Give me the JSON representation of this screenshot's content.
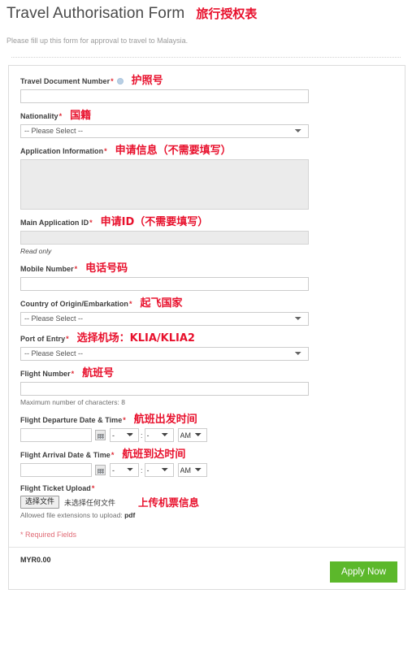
{
  "header": {
    "title": "Travel Authorisation Form",
    "title_annotation": "旅行授权表",
    "subtitle": "Please fill up this form for approval to travel to Malaysia."
  },
  "form": {
    "fields": [
      {
        "id": "travel-document-number",
        "label": "Travel Document Number",
        "required_mark": "*",
        "has_help_icon": true,
        "annotation": "护照号",
        "control": "text",
        "value": ""
      },
      {
        "id": "nationality",
        "label": "Nationality",
        "required_mark": "*",
        "annotation": "国籍",
        "control": "select",
        "selected": "-- Please Select --"
      },
      {
        "id": "application-information",
        "label": "Application Information",
        "required_mark": "*",
        "annotation": "申请信息（不需要填写）",
        "control": "textarea",
        "value": "",
        "disabled": true
      },
      {
        "id": "main-application-id",
        "label": "Main Application ID",
        "required_mark": "*",
        "annotation": "申请ID（不需要填写）",
        "control": "text",
        "value": "",
        "readonly": true,
        "hint": "Read only"
      },
      {
        "id": "mobile-number",
        "label": "Mobile Number",
        "required_mark": "*",
        "annotation": "电话号码",
        "control": "text",
        "value": ""
      },
      {
        "id": "country-of-origin",
        "label": "Country of Origin/Embarkation",
        "required_mark": "*",
        "annotation": "起飞国家",
        "control": "select",
        "selected": "-- Please Select --"
      },
      {
        "id": "port-of-entry",
        "label": "Port of Entry",
        "required_mark": "*",
        "annotation": "选择机场：KLIA/KLIA2",
        "control": "select",
        "selected": "-- Please Select --"
      },
      {
        "id": "flight-number",
        "label": "Flight Number",
        "required_mark": "*",
        "annotation": "航班号",
        "control": "text",
        "value": "",
        "hint": "Maximum number of characters: 8"
      },
      {
        "id": "flight-departure-datetime",
        "label": "Flight Departure Date & Time",
        "required_mark": "*",
        "annotation": "航班出发时间",
        "control": "datetime",
        "date_value": "",
        "hour": "-",
        "minute": "-",
        "meridiem": "AM",
        "separator": ":"
      },
      {
        "id": "flight-arrival-datetime",
        "label": "Flight Arrival Date & Time",
        "required_mark": "*",
        "annotation": "航班到达时间",
        "control": "datetime",
        "date_value": "",
        "hour": "-",
        "minute": "-",
        "meridiem": "AM",
        "separator": ":"
      },
      {
        "id": "flight-ticket-upload",
        "label": "Flight Ticket Upload",
        "required_mark": "*",
        "annotation": "上传机票信息",
        "control": "file",
        "button_label": "选择文件",
        "file_status": "未选择任何文件",
        "hint_prefix": "Allowed file extensions to upload: ",
        "hint_value": "pdf"
      }
    ],
    "required_note": "* Required Fields",
    "footer": {
      "price": "MYR0.00",
      "apply_label": "Apply Now"
    }
  },
  "colors": {
    "annotation_red": "#e8112d",
    "required_red": "#e02b36",
    "apply_green": "#5cb82b",
    "disabled_gray": "#ebebeb"
  },
  "select_options": {
    "placeholder": "-- Please Select --"
  }
}
